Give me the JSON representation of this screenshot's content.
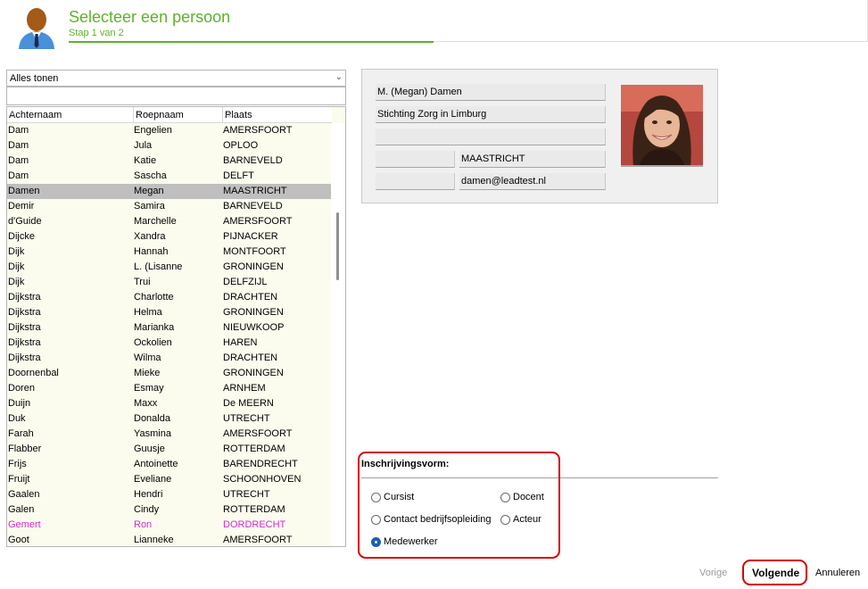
{
  "header": {
    "title": "Selecteer een persoon",
    "subtitle": "Stap 1 van 2"
  },
  "filter": {
    "value": "Alles tonen"
  },
  "search": {
    "value": ""
  },
  "table": {
    "columns": [
      "Achternaam",
      "Roepnaam",
      "Plaats"
    ],
    "rows": [
      [
        "Dam",
        "Engelien",
        "AMERSFOORT"
      ],
      [
        "Dam",
        "Jula",
        "OPLOO"
      ],
      [
        "Dam",
        "Katie",
        "BARNEVELD"
      ],
      [
        "Dam",
        "Sascha",
        "DELFT"
      ],
      [
        "Damen",
        "Megan",
        "MAASTRICHT"
      ],
      [
        "Demir",
        "Samira",
        "BARNEVELD"
      ],
      [
        "d'Guide",
        "Marchelle",
        "AMERSFOORT"
      ],
      [
        "Dijcke",
        "Xandra",
        "PIJNACKER"
      ],
      [
        "Dijk",
        "Hannah",
        "MONTFOORT"
      ],
      [
        "Dijk",
        "L. (Lisanne",
        "GRONINGEN"
      ],
      [
        "Dijk",
        "Trui",
        "DELFZIJL"
      ],
      [
        "Dijkstra",
        "Charlotte",
        "DRACHTEN"
      ],
      [
        "Dijkstra",
        "Helma",
        "GRONINGEN"
      ],
      [
        "Dijkstra",
        "Marianka",
        "NIEUWKOOP"
      ],
      [
        "Dijkstra",
        "Ockolien",
        "HAREN"
      ],
      [
        "Dijkstra",
        "Wilma",
        "DRACHTEN"
      ],
      [
        "Doornenbal",
        "Mieke",
        "GRONINGEN"
      ],
      [
        "Doren",
        "Esmay",
        "ARNHEM"
      ],
      [
        "Duijn",
        "Maxx",
        "De MEERN"
      ],
      [
        "Duk",
        "Donalda",
        "UTRECHT"
      ],
      [
        "Farah",
        "Yasmina",
        "AMERSFOORT"
      ],
      [
        "Flabber",
        "Guusje",
        "ROTTERDAM"
      ],
      [
        "Frijs",
        "Antoinette",
        "BARENDRECHT"
      ],
      [
        "Fruijt",
        "Eveliane",
        "SCHOONHOVEN"
      ],
      [
        "Gaalen",
        "Hendri",
        "UTRECHT"
      ],
      [
        "Galen",
        "Cindy",
        "ROTTERDAM"
      ],
      [
        "Gemert",
        "Ron",
        "DORDRECHT"
      ],
      [
        "Goot",
        "Lianneke",
        "AMERSFOORT"
      ]
    ],
    "selected_row": 4,
    "highlighted_row": 26,
    "highlight_color": "#d12ad1"
  },
  "person": {
    "name": "M. (Megan) Damen",
    "organisation": "Stichting Zorg in Limburg",
    "address": "",
    "postcode": "",
    "city": "MAASTRICHT",
    "phone": "",
    "email": "damen@leadtest.nl"
  },
  "inschrijving": {
    "title": "Inschrijvingsvorm:",
    "options": [
      "Cursist",
      "Docent",
      "Contact bedrijfsopleiding",
      "Acteur",
      "Medewerker"
    ],
    "selected": "Medewerker"
  },
  "footer": {
    "prev": "Vorige",
    "next": "Volgende",
    "cancel": "Annuleren"
  },
  "colors": {
    "accent": "#5fb12a",
    "highlight_box": "#d70000",
    "radio_selected": "#1a5fb4"
  },
  "icons": {
    "header": "person-icon"
  }
}
